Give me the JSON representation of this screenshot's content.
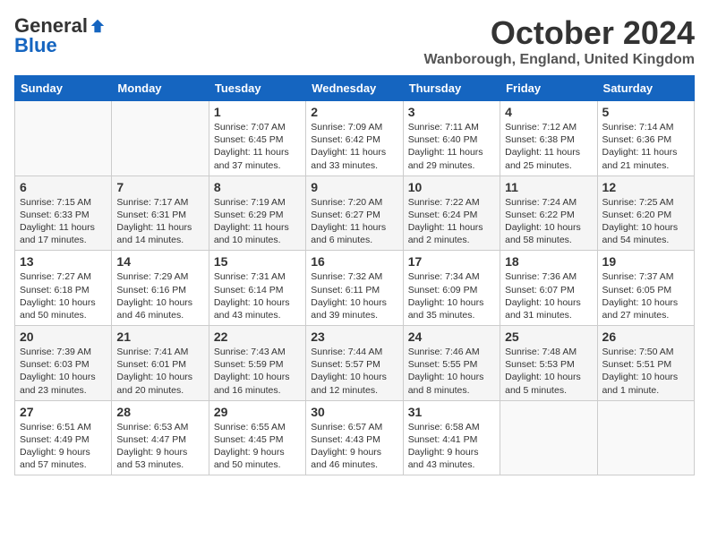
{
  "app": {
    "name_general": "General",
    "name_blue": "Blue"
  },
  "header": {
    "month": "October 2024",
    "location": "Wanborough, England, United Kingdom"
  },
  "weekdays": [
    "Sunday",
    "Monday",
    "Tuesday",
    "Wednesday",
    "Thursday",
    "Friday",
    "Saturday"
  ],
  "weeks": [
    [
      {
        "day": "",
        "sunrise": "",
        "sunset": "",
        "daylight": ""
      },
      {
        "day": "",
        "sunrise": "",
        "sunset": "",
        "daylight": ""
      },
      {
        "day": "1",
        "sunrise": "Sunrise: 7:07 AM",
        "sunset": "Sunset: 6:45 PM",
        "daylight": "Daylight: 11 hours and 37 minutes."
      },
      {
        "day": "2",
        "sunrise": "Sunrise: 7:09 AM",
        "sunset": "Sunset: 6:42 PM",
        "daylight": "Daylight: 11 hours and 33 minutes."
      },
      {
        "day": "3",
        "sunrise": "Sunrise: 7:11 AM",
        "sunset": "Sunset: 6:40 PM",
        "daylight": "Daylight: 11 hours and 29 minutes."
      },
      {
        "day": "4",
        "sunrise": "Sunrise: 7:12 AM",
        "sunset": "Sunset: 6:38 PM",
        "daylight": "Daylight: 11 hours and 25 minutes."
      },
      {
        "day": "5",
        "sunrise": "Sunrise: 7:14 AM",
        "sunset": "Sunset: 6:36 PM",
        "daylight": "Daylight: 11 hours and 21 minutes."
      }
    ],
    [
      {
        "day": "6",
        "sunrise": "Sunrise: 7:15 AM",
        "sunset": "Sunset: 6:33 PM",
        "daylight": "Daylight: 11 hours and 17 minutes."
      },
      {
        "day": "7",
        "sunrise": "Sunrise: 7:17 AM",
        "sunset": "Sunset: 6:31 PM",
        "daylight": "Daylight: 11 hours and 14 minutes."
      },
      {
        "day": "8",
        "sunrise": "Sunrise: 7:19 AM",
        "sunset": "Sunset: 6:29 PM",
        "daylight": "Daylight: 11 hours and 10 minutes."
      },
      {
        "day": "9",
        "sunrise": "Sunrise: 7:20 AM",
        "sunset": "Sunset: 6:27 PM",
        "daylight": "Daylight: 11 hours and 6 minutes."
      },
      {
        "day": "10",
        "sunrise": "Sunrise: 7:22 AM",
        "sunset": "Sunset: 6:24 PM",
        "daylight": "Daylight: 11 hours and 2 minutes."
      },
      {
        "day": "11",
        "sunrise": "Sunrise: 7:24 AM",
        "sunset": "Sunset: 6:22 PM",
        "daylight": "Daylight: 10 hours and 58 minutes."
      },
      {
        "day": "12",
        "sunrise": "Sunrise: 7:25 AM",
        "sunset": "Sunset: 6:20 PM",
        "daylight": "Daylight: 10 hours and 54 minutes."
      }
    ],
    [
      {
        "day": "13",
        "sunrise": "Sunrise: 7:27 AM",
        "sunset": "Sunset: 6:18 PM",
        "daylight": "Daylight: 10 hours and 50 minutes."
      },
      {
        "day": "14",
        "sunrise": "Sunrise: 7:29 AM",
        "sunset": "Sunset: 6:16 PM",
        "daylight": "Daylight: 10 hours and 46 minutes."
      },
      {
        "day": "15",
        "sunrise": "Sunrise: 7:31 AM",
        "sunset": "Sunset: 6:14 PM",
        "daylight": "Daylight: 10 hours and 43 minutes."
      },
      {
        "day": "16",
        "sunrise": "Sunrise: 7:32 AM",
        "sunset": "Sunset: 6:11 PM",
        "daylight": "Daylight: 10 hours and 39 minutes."
      },
      {
        "day": "17",
        "sunrise": "Sunrise: 7:34 AM",
        "sunset": "Sunset: 6:09 PM",
        "daylight": "Daylight: 10 hours and 35 minutes."
      },
      {
        "day": "18",
        "sunrise": "Sunrise: 7:36 AM",
        "sunset": "Sunset: 6:07 PM",
        "daylight": "Daylight: 10 hours and 31 minutes."
      },
      {
        "day": "19",
        "sunrise": "Sunrise: 7:37 AM",
        "sunset": "Sunset: 6:05 PM",
        "daylight": "Daylight: 10 hours and 27 minutes."
      }
    ],
    [
      {
        "day": "20",
        "sunrise": "Sunrise: 7:39 AM",
        "sunset": "Sunset: 6:03 PM",
        "daylight": "Daylight: 10 hours and 23 minutes."
      },
      {
        "day": "21",
        "sunrise": "Sunrise: 7:41 AM",
        "sunset": "Sunset: 6:01 PM",
        "daylight": "Daylight: 10 hours and 20 minutes."
      },
      {
        "day": "22",
        "sunrise": "Sunrise: 7:43 AM",
        "sunset": "Sunset: 5:59 PM",
        "daylight": "Daylight: 10 hours and 16 minutes."
      },
      {
        "day": "23",
        "sunrise": "Sunrise: 7:44 AM",
        "sunset": "Sunset: 5:57 PM",
        "daylight": "Daylight: 10 hours and 12 minutes."
      },
      {
        "day": "24",
        "sunrise": "Sunrise: 7:46 AM",
        "sunset": "Sunset: 5:55 PM",
        "daylight": "Daylight: 10 hours and 8 minutes."
      },
      {
        "day": "25",
        "sunrise": "Sunrise: 7:48 AM",
        "sunset": "Sunset: 5:53 PM",
        "daylight": "Daylight: 10 hours and 5 minutes."
      },
      {
        "day": "26",
        "sunrise": "Sunrise: 7:50 AM",
        "sunset": "Sunset: 5:51 PM",
        "daylight": "Daylight: 10 hours and 1 minute."
      }
    ],
    [
      {
        "day": "27",
        "sunrise": "Sunrise: 6:51 AM",
        "sunset": "Sunset: 4:49 PM",
        "daylight": "Daylight: 9 hours and 57 minutes."
      },
      {
        "day": "28",
        "sunrise": "Sunrise: 6:53 AM",
        "sunset": "Sunset: 4:47 PM",
        "daylight": "Daylight: 9 hours and 53 minutes."
      },
      {
        "day": "29",
        "sunrise": "Sunrise: 6:55 AM",
        "sunset": "Sunset: 4:45 PM",
        "daylight": "Daylight: 9 hours and 50 minutes."
      },
      {
        "day": "30",
        "sunrise": "Sunrise: 6:57 AM",
        "sunset": "Sunset: 4:43 PM",
        "daylight": "Daylight: 9 hours and 46 minutes."
      },
      {
        "day": "31",
        "sunrise": "Sunrise: 6:58 AM",
        "sunset": "Sunset: 4:41 PM",
        "daylight": "Daylight: 9 hours and 43 minutes."
      },
      {
        "day": "",
        "sunrise": "",
        "sunset": "",
        "daylight": ""
      },
      {
        "day": "",
        "sunrise": "",
        "sunset": "",
        "daylight": ""
      }
    ]
  ]
}
